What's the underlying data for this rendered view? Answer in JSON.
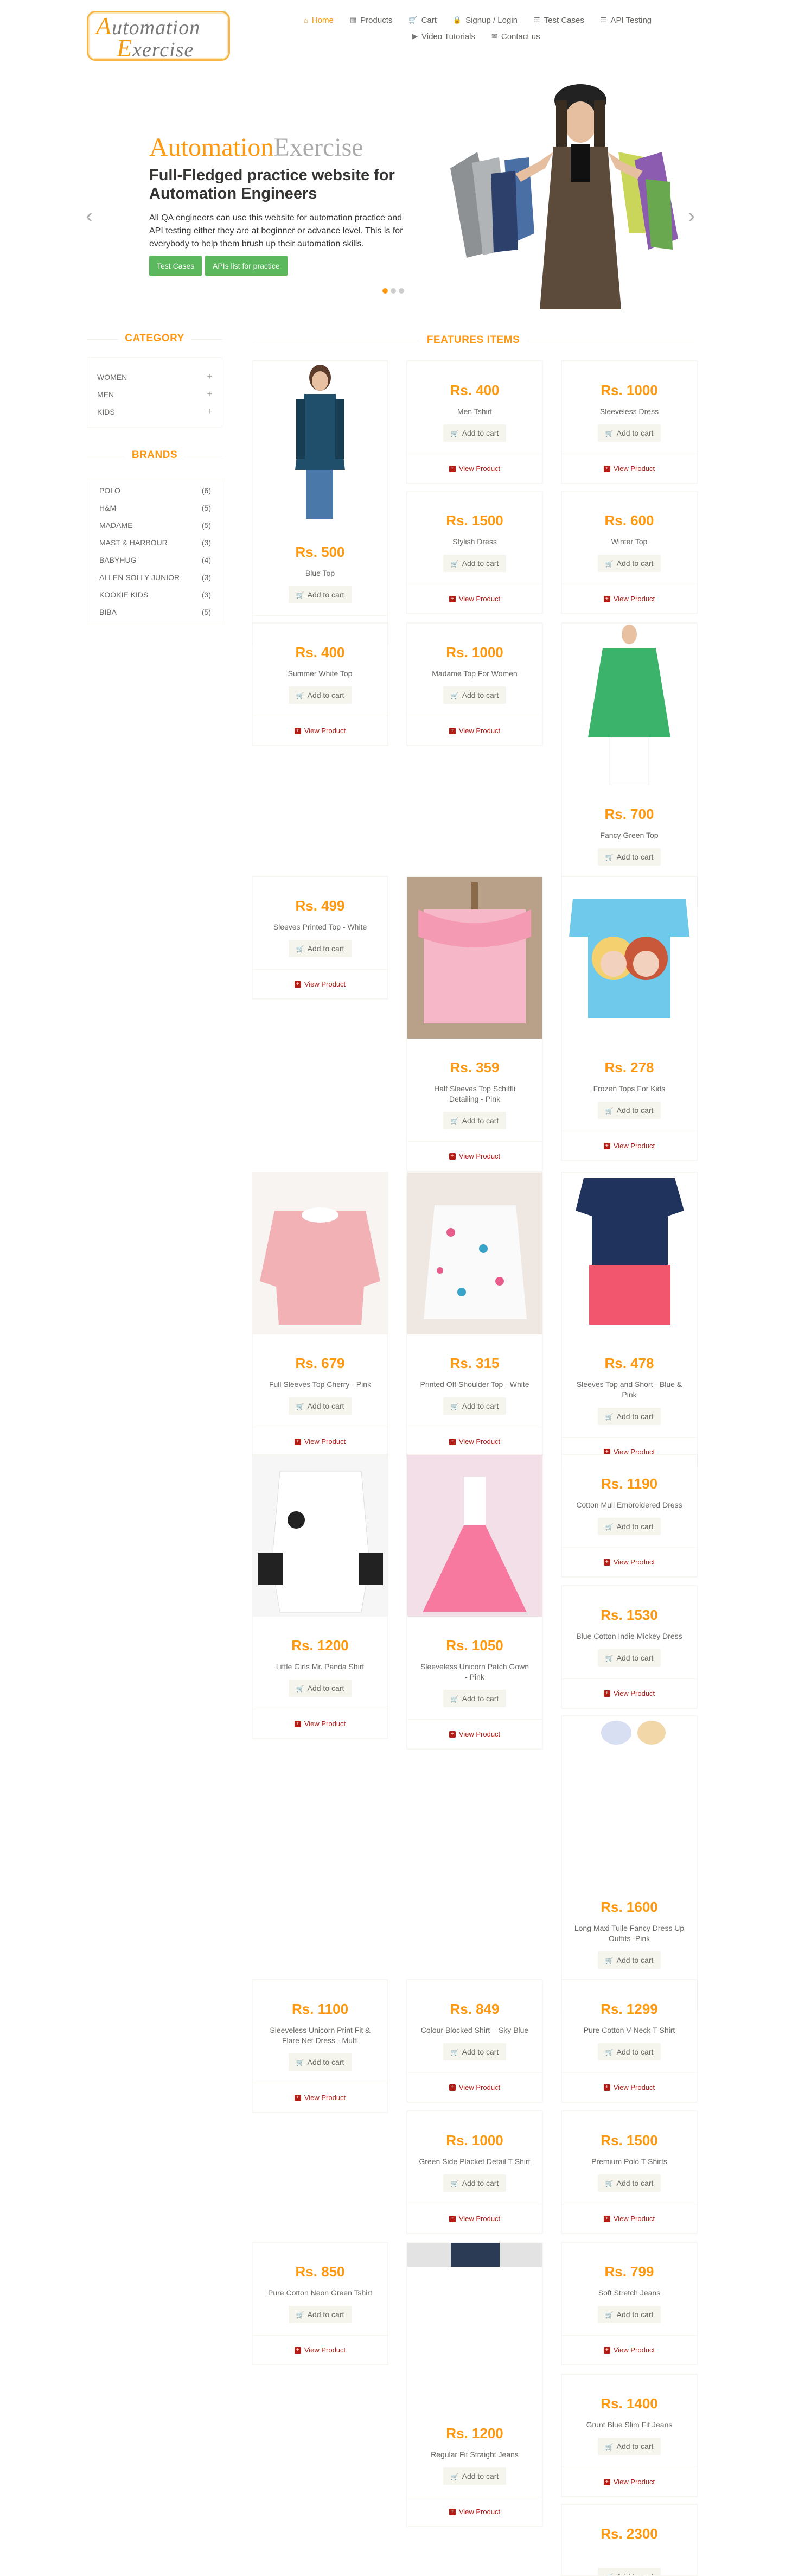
{
  "header": {
    "logo_line1": "Automation",
    "logo_line2": "Exercise",
    "nav": [
      {
        "label": "Home",
        "icon": "home-icon"
      },
      {
        "label": "Products",
        "icon": "tshirt-icon"
      },
      {
        "label": "Cart",
        "icon": "cart-icon"
      },
      {
        "label": "Signup / Login",
        "icon": "lock-icon"
      },
      {
        "label": "Test Cases",
        "icon": "list-icon"
      },
      {
        "label": "API Testing",
        "icon": "list-icon"
      },
      {
        "label": "Video Tutorials",
        "icon": "youtube-icon"
      },
      {
        "label": "Contact us",
        "icon": "envelope-icon"
      }
    ]
  },
  "slider": {
    "title_part1": "Automation",
    "title_part2": "Exercise",
    "subtitle": "Full-Fledged practice website for Automation Engineers",
    "description": "All QA engineers can use this website for automation practice and API testing either they are at beginner or advance level. This is for everybody to help them brush up their automation skills.",
    "btn_test_cases": "Test Cases",
    "btn_apis": "APIs list for practice"
  },
  "sidebar": {
    "category_title": "CATEGORY",
    "categories": [
      "WOMEN",
      "MEN",
      "KIDS"
    ],
    "brands_title": "BRANDS",
    "brands": [
      {
        "name": "POLO",
        "count": "(6)"
      },
      {
        "name": "H&M",
        "count": "(5)"
      },
      {
        "name": "MADAME",
        "count": "(5)"
      },
      {
        "name": "MAST & HARBOUR",
        "count": "(3)"
      },
      {
        "name": "BABYHUG",
        "count": "(4)"
      },
      {
        "name": "ALLEN SOLLY JUNIOR",
        "count": "(3)"
      },
      {
        "name": "KOOKIE KIDS",
        "count": "(3)"
      },
      {
        "name": "BIBA",
        "count": "(5)"
      }
    ]
  },
  "features_title": "FEATURES ITEMS",
  "add_to_cart": "Add to cart",
  "view_product": "View Product",
  "products": [
    {
      "price": "Rs. 500",
      "name": "Blue Top"
    },
    {
      "price": "Rs. 400",
      "name": "Men Tshirt"
    },
    {
      "price": "Rs. 1000",
      "name": "Sleeveless Dress"
    },
    {
      "price": "Rs. 1500",
      "name": "Stylish Dress"
    },
    {
      "price": "Rs. 600",
      "name": "Winter Top"
    },
    {
      "price": "Rs. 400",
      "name": "Summer White Top"
    },
    {
      "price": "Rs. 1000",
      "name": "Madame Top For Women"
    },
    {
      "price": "Rs. 700",
      "name": "Fancy Green Top"
    },
    {
      "price": "Rs. 499",
      "name": "Sleeves Printed Top - White"
    },
    {
      "price": "Rs. 359",
      "name": "Half Sleeves Top Schiffli Detailing - Pink"
    },
    {
      "price": "Rs. 278",
      "name": "Frozen Tops For Kids"
    },
    {
      "price": "Rs. 679",
      "name": "Full Sleeves Top Cherry - Pink"
    },
    {
      "price": "Rs. 315",
      "name": "Printed Off Shoulder Top - White"
    },
    {
      "price": "Rs. 478",
      "name": "Sleeves Top and Short - Blue & Pink"
    },
    {
      "price": "Rs. 1200",
      "name": "Little Girls Mr. Panda Shirt"
    },
    {
      "price": "Rs. 1050",
      "name": "Sleeveless Unicorn Patch Gown - Pink"
    },
    {
      "price": "Rs. 1190",
      "name": "Cotton Mull Embroidered Dress"
    },
    {
      "price": "Rs. 1530",
      "name": "Blue Cotton Indie Mickey Dress"
    },
    {
      "price": "Rs. 1600",
      "name": "Long Maxi Tulle Fancy Dress Up Outfits -Pink"
    },
    {
      "price": "Rs. 1100",
      "name": "Sleeveless Unicorn Print Fit & Flare Net Dress - Multi"
    },
    {
      "price": "Rs. 849",
      "name": "Colour Blocked Shirt – Sky Blue"
    },
    {
      "price": "Rs. 1299",
      "name": "Pure Cotton V-Neck T-Shirt"
    },
    {
      "price": "Rs. 1000",
      "name": "Green Side Placket Detail T-Shirt"
    },
    {
      "price": "Rs. 1500",
      "name": "Premium Polo T-Shirts"
    },
    {
      "price": "Rs. 850",
      "name": "Pure Cotton Neon Green Tshirt"
    },
    {
      "price": "Rs. 1200",
      "name": "Regular Fit Straight Jeans"
    },
    {
      "price": "Rs. 799",
      "name": "Soft Stretch Jeans"
    },
    {
      "price": "Rs. 1400",
      "name": "Grunt Blue Slim Fit Jeans"
    },
    {
      "price": "Rs. 2300",
      "name": ""
    }
  ],
  "colors": {
    "accent": "#FE980F",
    "green": "#5CB85C",
    "view": "#B21D16"
  }
}
